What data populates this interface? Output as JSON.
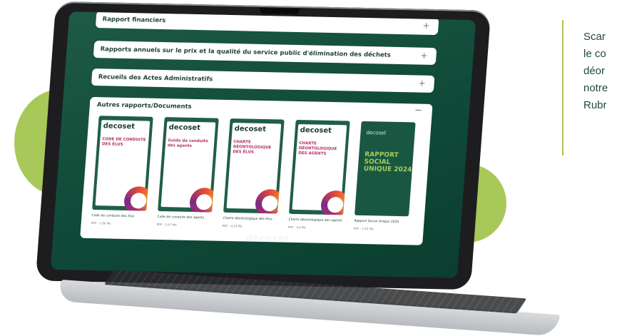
{
  "page": {
    "side_text_lines": [
      "Scar",
      "le co",
      "déor",
      "notre",
      "Rubr"
    ],
    "accent": "#a9c85a",
    "brand_dark": "#0f4a38"
  },
  "site": {
    "accordion": [
      {
        "label": "Rapport financiers",
        "icon": "+"
      },
      {
        "label": "Rapports annuels sur le prix et la qualité du service public d'élimination des déchets",
        "icon": "+"
      },
      {
        "label": "Recueils des Actes Administratifs",
        "icon": "+"
      }
    ],
    "open_section": {
      "label": "Autres rapports/Documents",
      "icon": "−"
    },
    "documents": [
      {
        "cover_brand": "decoset",
        "cover_title": "CODE DE CONDUITE DES ÉLUS",
        "cover_sub": "",
        "caption": "Code de conduite des élus",
        "meta": "PDF - 2,96 Mo"
      },
      {
        "cover_brand": "decoset",
        "cover_title": "Guide de conduite des agents",
        "cover_sub": "",
        "caption": "Code de conduite des agents",
        "meta": "PDF - 2,67 Mo"
      },
      {
        "cover_brand": "decoset",
        "cover_title": "CHARTE DÉONTOLOGIQUE DES ÉLUS",
        "cover_sub": "",
        "caption": "Charte déontologique des élus",
        "meta": "PDF - 4,33 Mo"
      },
      {
        "cover_brand": "decoset",
        "cover_title": "CHARTE DÉONTOLOGIQUE DES AGENTS",
        "cover_sub": "",
        "caption": "Charte déontologique des agents",
        "meta": "PDF - 4,6 Mo"
      },
      {
        "cover_brand": "decoset",
        "cover_title": "RAPPORT SOCIAL UNIQUE 2024",
        "cover_sub": "",
        "caption": "Rapport Social Unique 2024",
        "meta": "PDF - 1,93 Mo"
      }
    ],
    "footer_logo": "decoset"
  }
}
